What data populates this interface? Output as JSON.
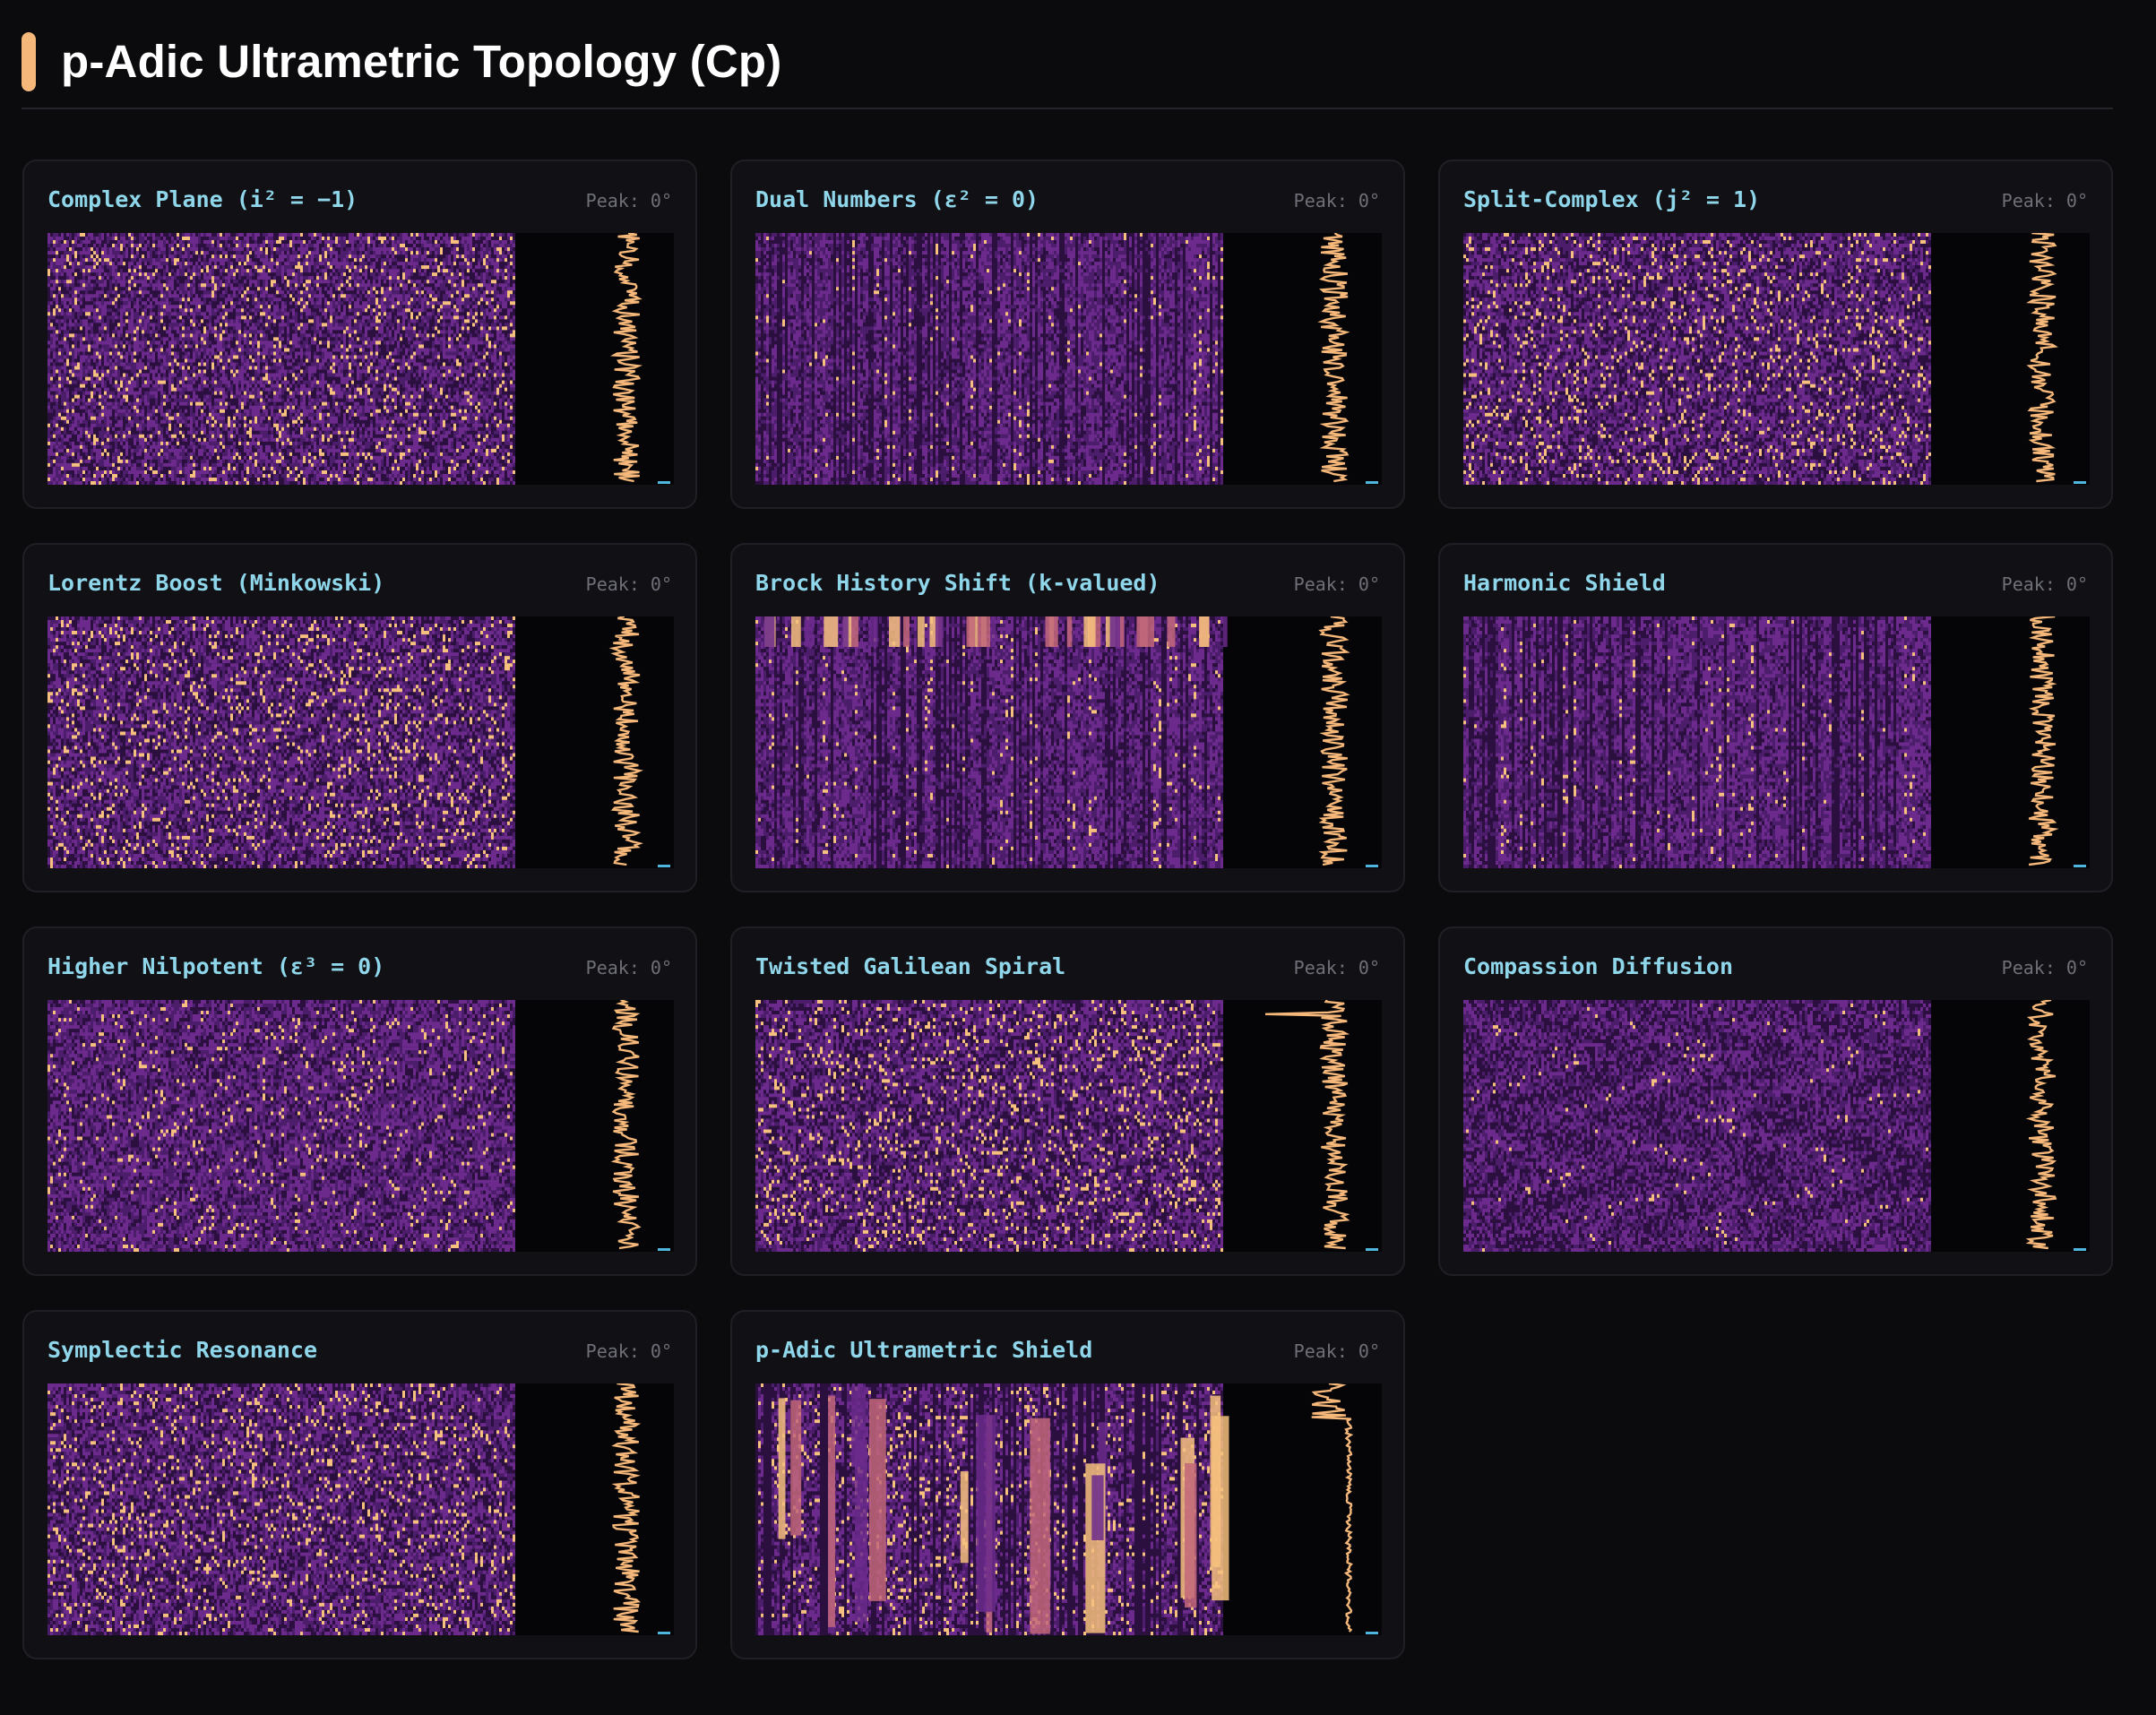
{
  "header": {
    "title": "p-Adic Ultrametric Topology (Cp)",
    "accent_color": "#f5b87a"
  },
  "colors": {
    "background": "#0b0b0e",
    "card_background": "#111115",
    "card_title": "#8fd6ea",
    "peak_text": "#6f6f78",
    "heatmap_dark": "#2a0f3f",
    "heatmap_mid": "#6b2a8c",
    "heatmap_light": "#f6c17e",
    "profile_line": "#f5b87a",
    "profile_marker": "#4fb6e0"
  },
  "panels": [
    {
      "title": "Complex Plane (i² = −1)",
      "peak": "Peak: 0°",
      "pattern": "noise",
      "seed": 11
    },
    {
      "title": "Dual Numbers (ε² = 0)",
      "peak": "Peak: 0°",
      "pattern": "vertical-bands",
      "seed": 23
    },
    {
      "title": "Split-Complex (j² = 1)",
      "peak": "Peak: 0°",
      "pattern": "noise",
      "seed": 37
    },
    {
      "title": "Lorentz Boost (Minkowski)",
      "peak": "Peak: 0°",
      "pattern": "noise",
      "seed": 41
    },
    {
      "title": "Brock History Shift (k-valued)",
      "peak": "Peak: 0°",
      "pattern": "vertical-bands-top-stripe",
      "seed": 53
    },
    {
      "title": "Harmonic Shield",
      "peak": "Peak: 0°",
      "pattern": "vertical-bands",
      "seed": 67
    },
    {
      "title": "Higher Nilpotent (ε³ = 0)",
      "peak": "Peak: 0°",
      "pattern": "diagonal-noise",
      "seed": 71
    },
    {
      "title": "Twisted Galilean Spiral",
      "peak": "Peak: 0°",
      "pattern": "noise",
      "seed": 83
    },
    {
      "title": "Compassion Diffusion",
      "peak": "Peak: 0°",
      "pattern": "swirl-noise",
      "seed": 97
    },
    {
      "title": "Symplectic Resonance",
      "peak": "Peak: 0°",
      "pattern": "noise",
      "seed": 101
    },
    {
      "title": "p-Adic Ultrametric Shield",
      "peak": "Peak: 0°",
      "pattern": "ultrametric",
      "seed": 113
    }
  ]
}
